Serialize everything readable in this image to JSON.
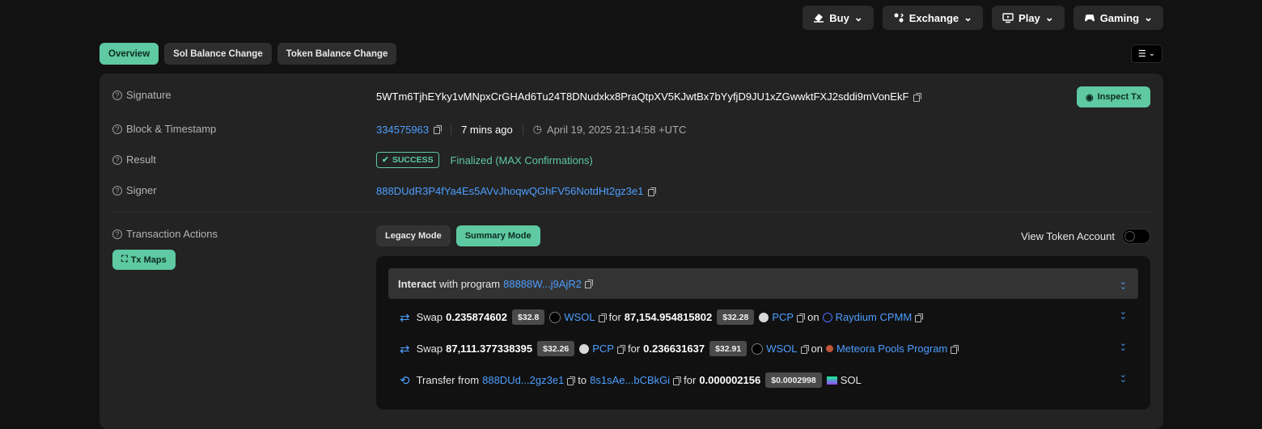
{
  "nav": {
    "buy": "Buy",
    "exchange": "Exchange",
    "play": "Play",
    "gaming": "Gaming"
  },
  "tabs": [
    "Overview",
    "Sol Balance Change",
    "Token Balance Change"
  ],
  "labels": {
    "signature": "Signature",
    "block": "Block & Timestamp",
    "result": "Result",
    "signer": "Signer",
    "actions": "Transaction Actions"
  },
  "signature": "5WTm6TjhEYky1vMNpxCrGHAd6Tu24T8DNudxkx8PraQtpXV5KJwtBx7bYyfjD9JU1xZGwwktFXJ2sddi9mVonEkF",
  "inspect_label": "Inspect Tx",
  "block": {
    "number": "334575963",
    "ago": "7 mins ago",
    "timestamp": "April 19, 2025 21:14:58 +UTC"
  },
  "result": {
    "badge": "SUCCESS",
    "status": "Finalized (MAX Confirmations)"
  },
  "signer": "888DUdR3P4fYa4Es5AVvJhoqwQGhFV56NotdHt2gz3e1",
  "txmaps_label": "Tx Maps",
  "modes": {
    "legacy": "Legacy Mode",
    "summary": "Summary Mode"
  },
  "view_token_account": "View Token Account",
  "interact": {
    "bold": "Interact",
    "text": "with program",
    "program": "88888W...j9AjR2"
  },
  "action_rows": [
    {
      "verb": "Swap",
      "amount1": "0.235874602",
      "price1": "$32.8",
      "token1": "WSOL",
      "for": "for",
      "amount2": "87,154.954815802",
      "price2": "$32.28",
      "token2": "PCP",
      "on": "on",
      "venue": "Raydium CPMM"
    },
    {
      "verb": "Swap",
      "amount1": "87,111.377338395",
      "price1": "$32.26",
      "token1": "PCP",
      "for": "for",
      "amount2": "0.236631637",
      "price2": "$32.91",
      "token2": "WSOL",
      "on": "on",
      "venue": "Meteora Pools Program"
    },
    {
      "verb": "Transfer from",
      "from": "888DUd...2gz3e1",
      "to_word": "to",
      "to": "8s1sAe...bCBkGi",
      "for": "for",
      "amount": "0.000002156",
      "price": "$0.0002998",
      "token": "SOL"
    }
  ],
  "colors": {
    "accent": "#5ec9a2",
    "link": "#4d9eff",
    "bg": "#121212",
    "panel": "#232323"
  }
}
